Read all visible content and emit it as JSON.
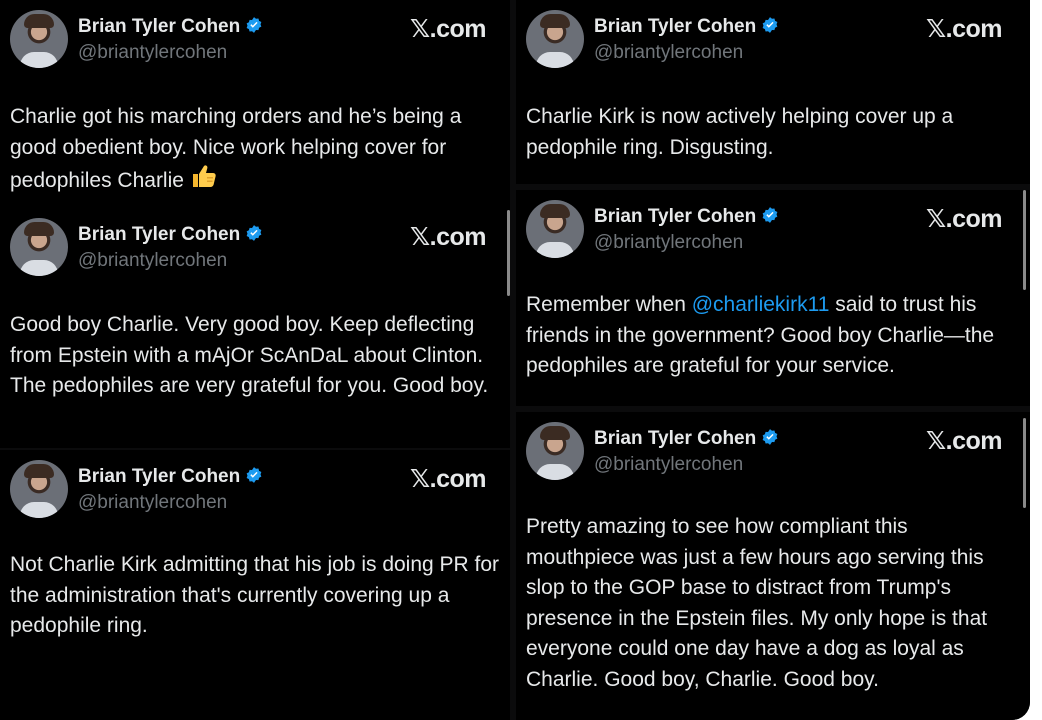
{
  "tweets": [
    {
      "name": "Brian Tyler Cohen",
      "handle": "@briantylercohen",
      "source": "𝕏.com",
      "text": "Charlie got his marching orders and he’s being a good obedient boy. Nice work helping cover for pedophiles Charlie",
      "emoji": "thumbs-up"
    },
    {
      "name": "Brian Tyler Cohen",
      "handle": "@briantylercohen",
      "source": "𝕏.com",
      "text": "Good boy Charlie. Very good boy. Keep deflecting from Epstein with a mAjOr ScAnDaL about Clinton. The pedophiles are very grateful for you. Good boy."
    },
    {
      "name": "Brian Tyler Cohen",
      "handle": "@briantylercohen",
      "source": "𝕏.com",
      "text": "Not Charlie Kirk admitting that his job is doing PR for the administration that's currently covering up a pedophile ring."
    },
    {
      "name": "Brian Tyler Cohen",
      "handle": "@briantylercohen",
      "source": "𝕏.com",
      "text": "Charlie Kirk is now actively helping cover up a pedophile ring. Disgusting."
    },
    {
      "name": "Brian Tyler Cohen",
      "handle": "@briantylercohen",
      "source": "𝕏.com",
      "text_before": "Remember when ",
      "mention": "@charliekirk11",
      "text_after": " said to trust his friends in the government? Good boy Charlie—the pedophiles are grateful for your service."
    },
    {
      "name": "Brian Tyler Cohen",
      "handle": "@briantylercohen",
      "source": "𝕏.com",
      "text": "Pretty amazing to see how compliant this mouthpiece was just a few hours ago serving this slop to the GOP base to distract from Trump's presence in the Epstein files. My only hope is that everyone could one day have a dog as loyal as Charlie. Good boy, Charlie. Good boy."
    }
  ],
  "colors": {
    "background": "#000000",
    "text": "#e7e9ea",
    "handle": "#71767b",
    "verified": "#1d9bf0",
    "mention": "#1d9bf0"
  }
}
